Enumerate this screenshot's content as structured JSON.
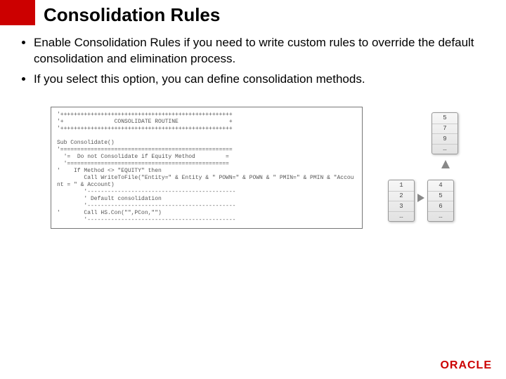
{
  "title": "Consolidation Rules",
  "bullets": {
    "b1": "Enable Consolidation Rules if you need to write custom rules to override the default consolidation and elimination process.",
    "b2": "If you select this option, you can define consolidation methods."
  },
  "code": "'+++++++++++++++++++++++++++++++++++++++++++++++++++\n'+               CONSOLIDATE ROUTINE               +\n'+++++++++++++++++++++++++++++++++++++++++++++++++++\n\nSub Consolidate()\n'===================================================\n  '=  Do not Consolidate if Equity Method         =\n  '================================================\n'    If Method <> \"EQUITY\" then\n        Call WriteToFile(\"Entity=\" & Entity & \" POWN=\" & POWN & \" PMIN=\" & PMIN & \"Account = \" & Account)\n        '--------------------------------------------\n        ' Default consolidation\n        '--------------------------------------------\n'       Call HS.Con(\"\",PCon,\"\")\n        '--------------------------------------------",
  "keypad1": {
    "r1": "1",
    "r2": "2",
    "r3": "3",
    "r4": "…"
  },
  "keypad2": {
    "r1": "4",
    "r2": "5",
    "r3": "6",
    "r4": "…"
  },
  "keypad3": {
    "r1": "5",
    "r2": "7",
    "r3": "9",
    "r4": "…"
  },
  "logo": "ORACLE"
}
